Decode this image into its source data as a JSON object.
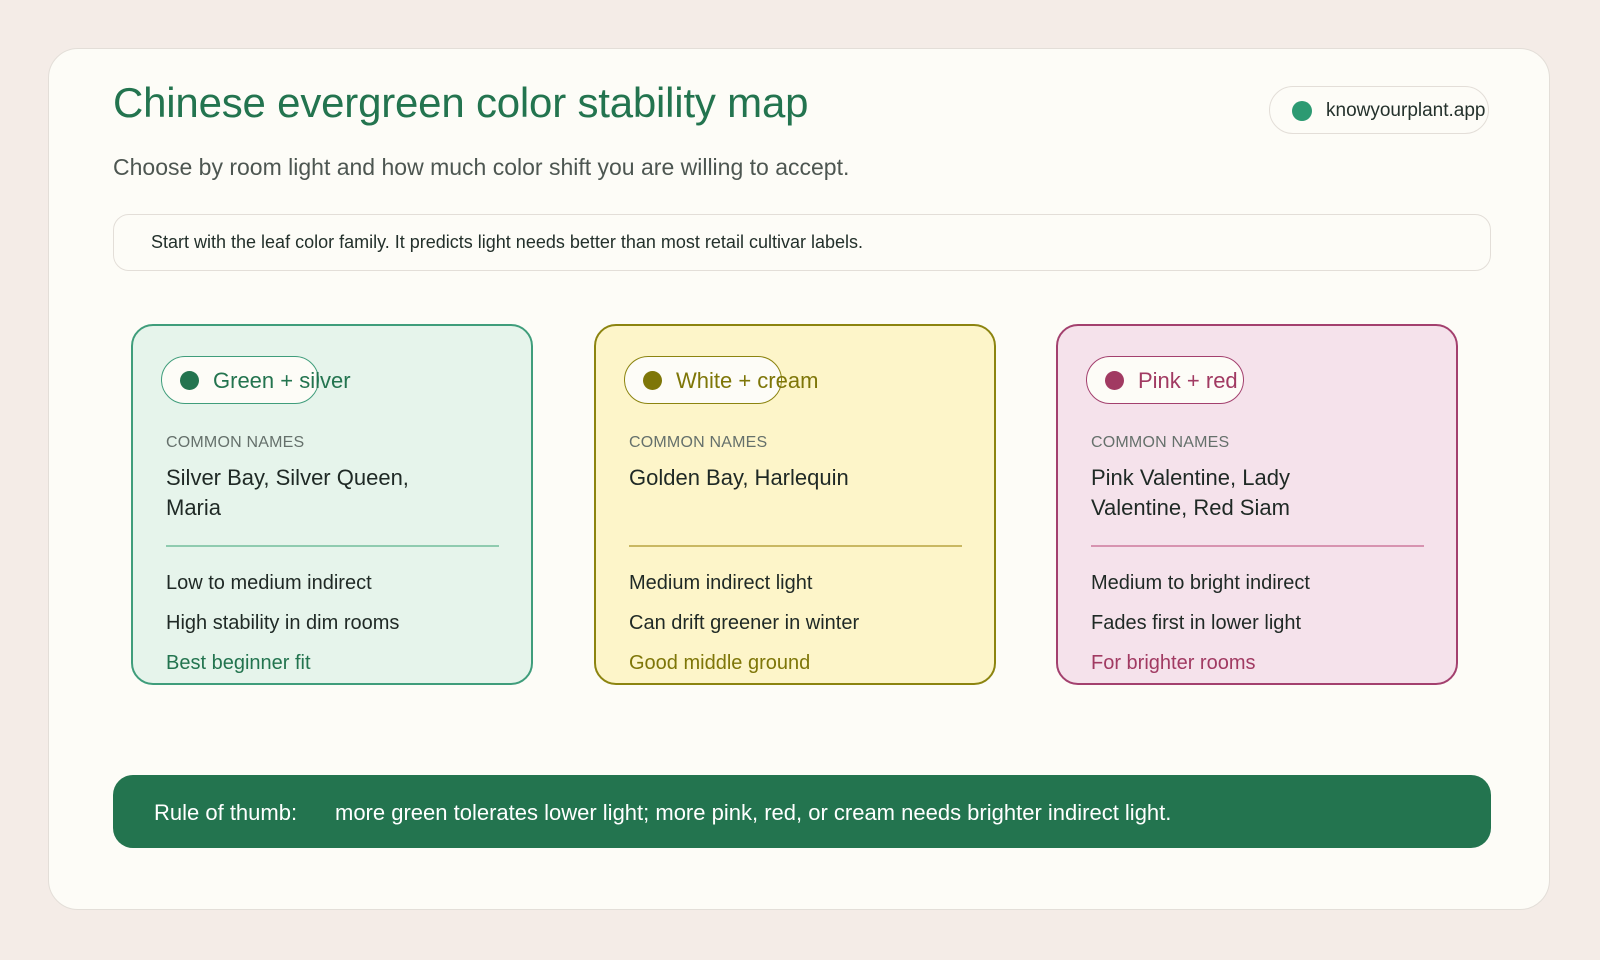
{
  "header": {
    "title": "Chinese evergreen color stability map",
    "subtitle": "Choose by room light and how much color shift you are willing to accept.",
    "brand": {
      "label": "knowyourplant.app",
      "dot_color": "#2c9a72"
    }
  },
  "note": {
    "text": "Start with the leaf color family. It predicts light needs better than most retail cultivar labels."
  },
  "cards": [
    {
      "family": "Green + silver",
      "accent_color": "#23744f",
      "names_heading": "COMMON NAMES",
      "names": "Silver Bay, Silver Queen, Maria",
      "light": "Low to medium indirect",
      "stability": "High stability in dim rooms",
      "verdict": "Best beginner fit"
    },
    {
      "family": "White + cream",
      "accent_color": "#7e7608",
      "names_heading": "COMMON NAMES",
      "names": "Golden Bay, Harlequin",
      "light": "Medium indirect light",
      "stability": "Can drift greener in winter",
      "verdict": "Good middle ground"
    },
    {
      "family": "Pink + red",
      "accent_color": "#a13a62",
      "names_heading": "COMMON NAMES",
      "names": "Pink Valentine, Lady Valentine, Red Siam",
      "light": "Medium to bright indirect",
      "stability": "Fades first in lower light",
      "verdict": "For brighter rooms"
    }
  ],
  "rule": {
    "label": "Rule of thumb:",
    "text": "more green tolerates lower light; more pink, red, or cream needs brighter indirect light.",
    "background": "#23744f"
  }
}
